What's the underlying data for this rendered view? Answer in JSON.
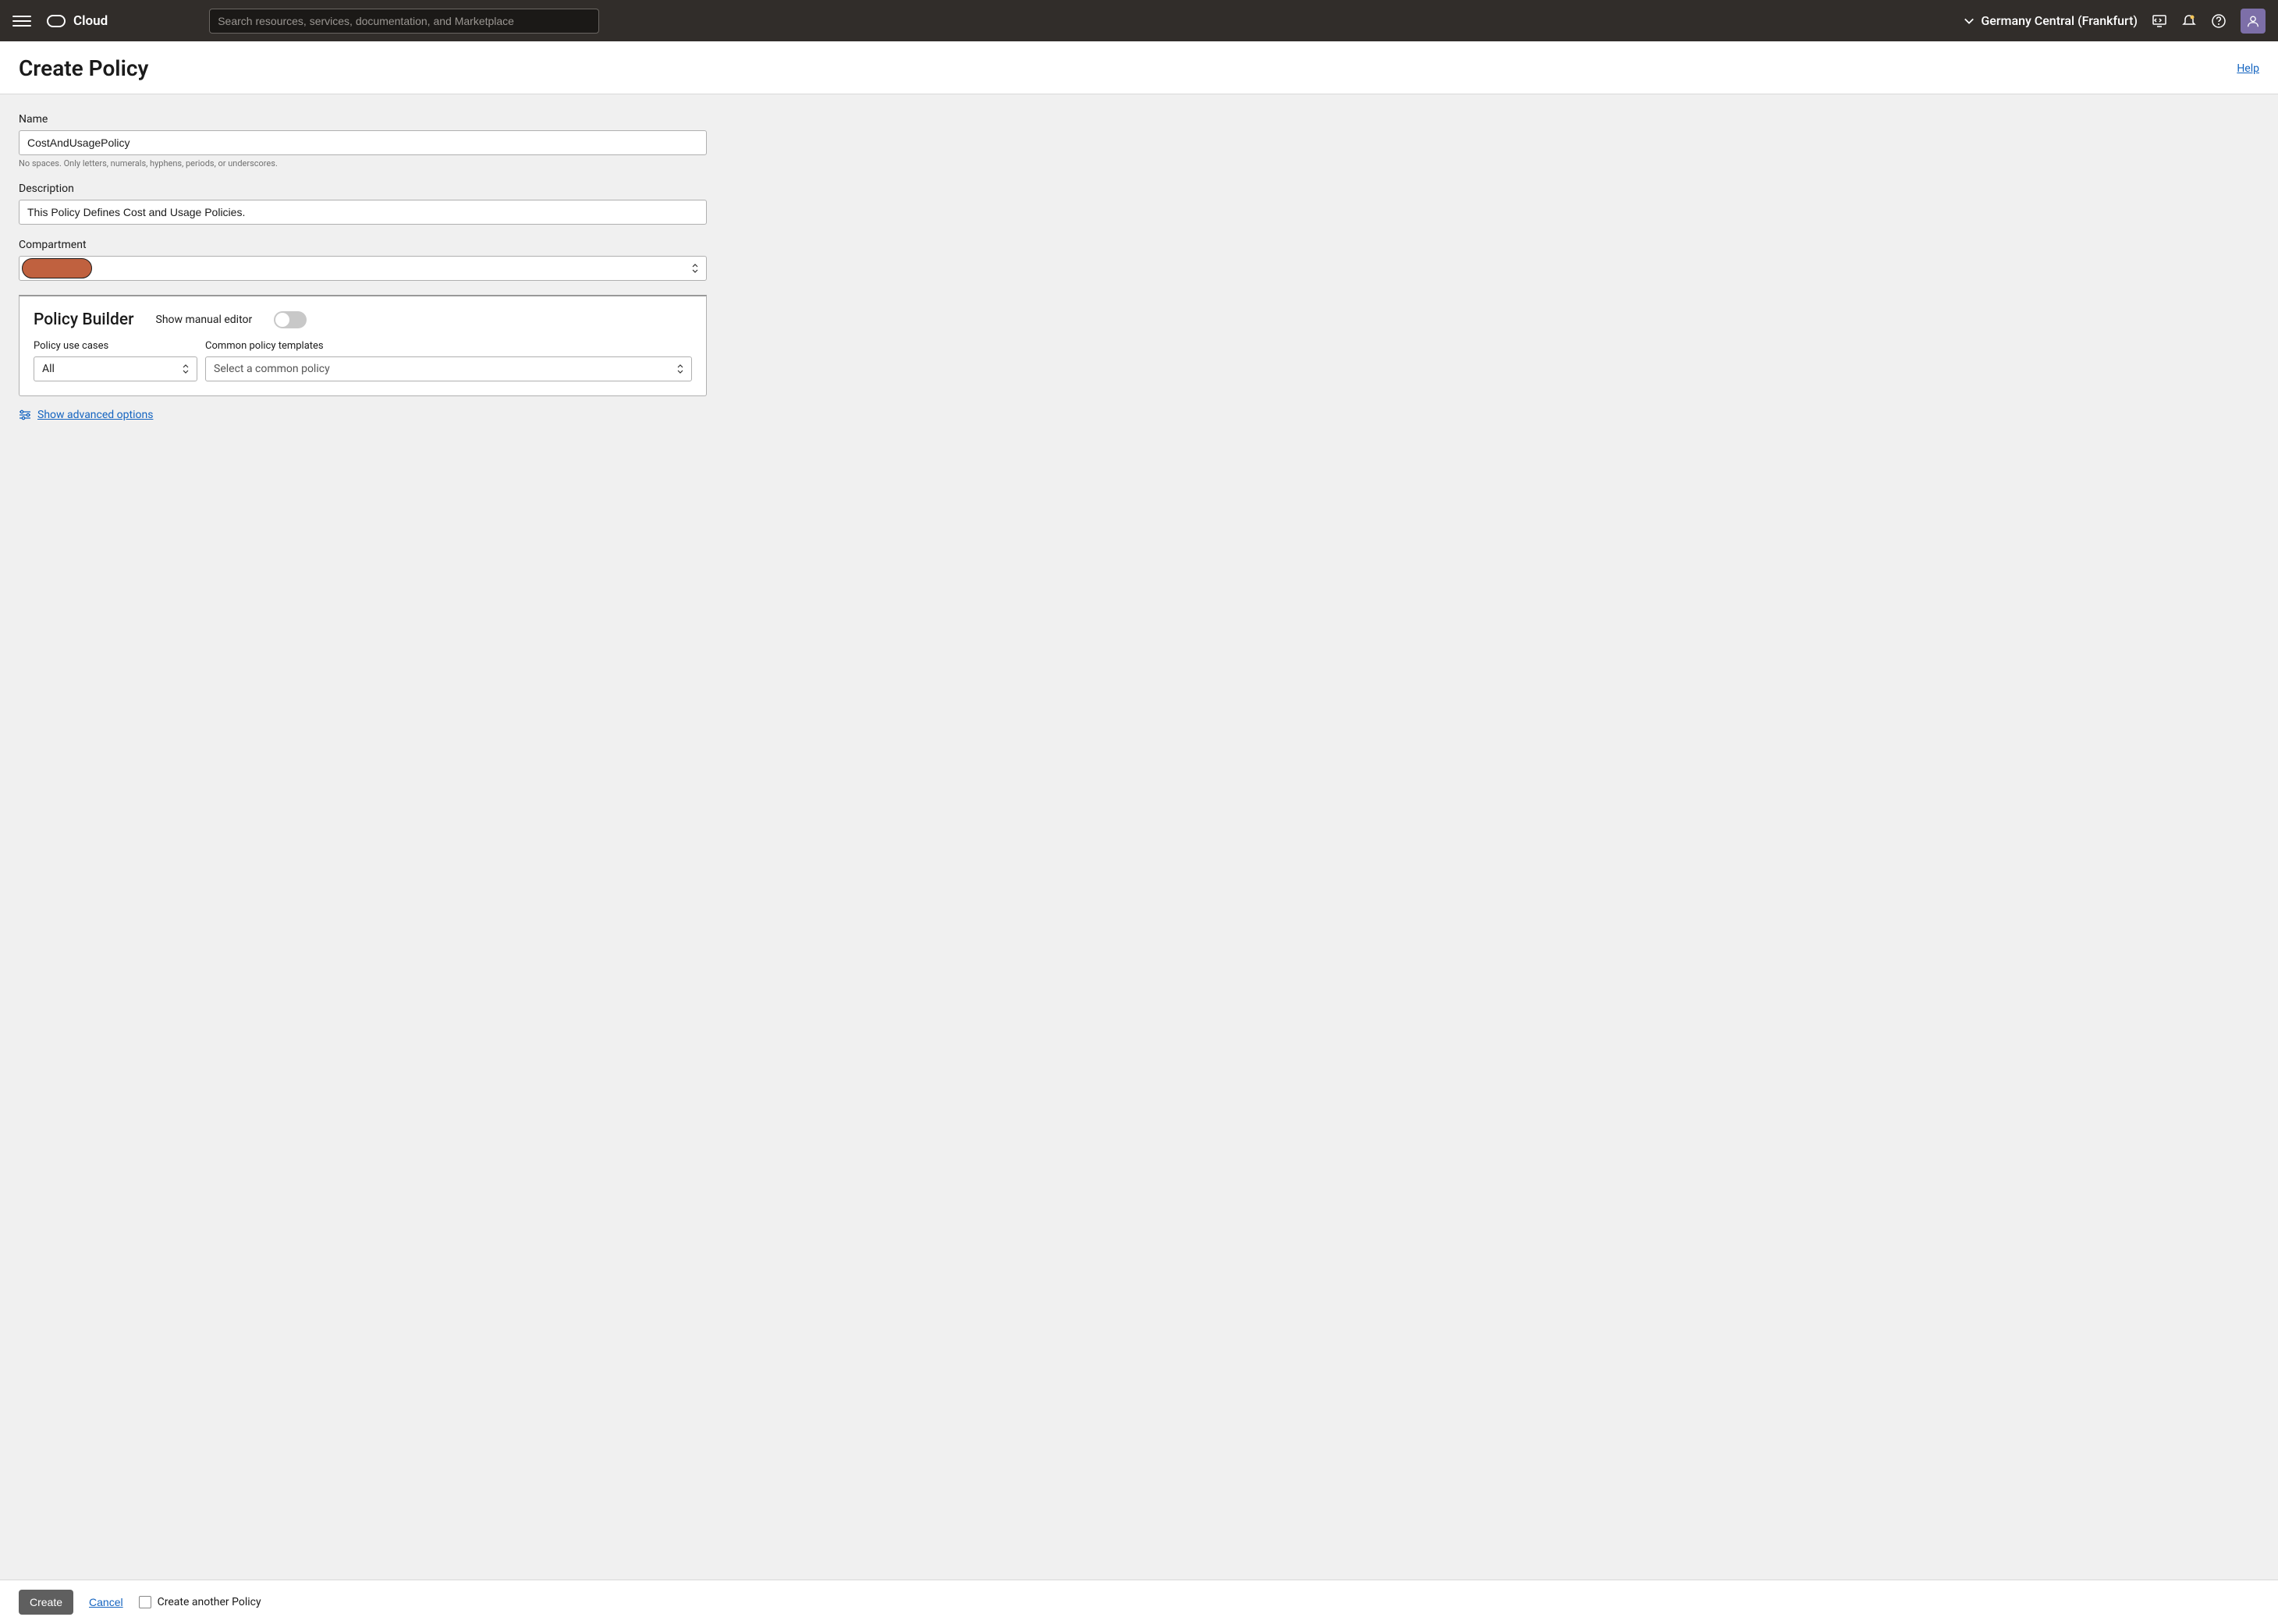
{
  "header": {
    "brand": "Cloud",
    "search_placeholder": "Search resources, services, documentation, and Marketplace",
    "region": "Germany Central (Frankfurt)"
  },
  "page": {
    "title": "Create Policy",
    "help_label": "Help"
  },
  "form": {
    "name_label": "Name",
    "name_value": "CostAndUsagePolicy",
    "name_helper": "No spaces. Only letters, numerals, hyphens, periods, or underscores.",
    "description_label": "Description",
    "description_value": "This Policy Defines Cost and Usage Policies.",
    "compartment_label": "Compartment",
    "compartment_value": ""
  },
  "builder": {
    "title": "Policy Builder",
    "manual_editor_label": "Show manual editor",
    "use_cases_label": "Policy use cases",
    "use_cases_value": "All",
    "templates_label": "Common policy templates",
    "templates_placeholder": "Select a common policy"
  },
  "advanced": {
    "label": "Show advanced options"
  },
  "footer": {
    "create_label": "Create",
    "cancel_label": "Cancel",
    "create_another_label": "Create another Policy"
  }
}
